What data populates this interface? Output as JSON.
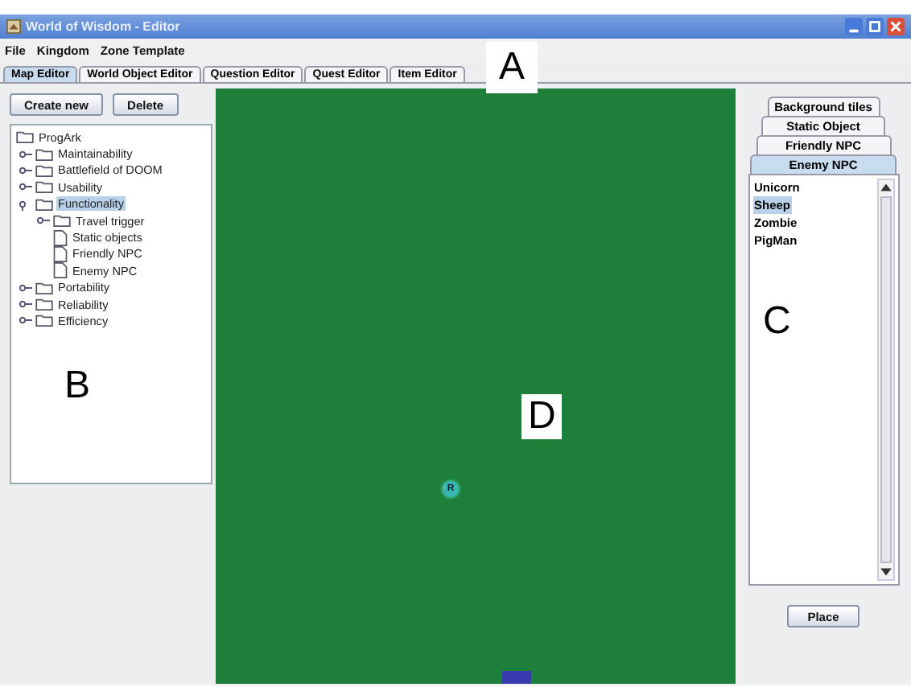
{
  "window": {
    "title": "World of Wisdom - Editor"
  },
  "menu": [
    "File",
    "Kingdom",
    "Zone Template"
  ],
  "tabs": [
    {
      "label": "Map Editor",
      "selected": true
    },
    {
      "label": "World Object Editor",
      "selected": false
    },
    {
      "label": "Question Editor",
      "selected": false
    },
    {
      "label": "Quest Editor",
      "selected": false
    },
    {
      "label": "Item Editor",
      "selected": false
    }
  ],
  "left_panel": {
    "buttons": [
      "Create new",
      "Delete"
    ],
    "tree": {
      "label": "ProgArk",
      "children": [
        {
          "label": "Maintainability",
          "kind": "folder",
          "expanded": false,
          "selected": false
        },
        {
          "label": "Battlefield of DOOM",
          "kind": "folder",
          "expanded": false,
          "selected": false
        },
        {
          "label": "Usability",
          "kind": "folder",
          "expanded": false,
          "selected": false
        },
        {
          "label": "Functionality",
          "kind": "folder",
          "expanded": true,
          "selected": true,
          "children": [
            {
              "label": "Travel trigger",
              "kind": "folder",
              "expanded": false,
              "selected": false
            },
            {
              "label": "Static objects",
              "kind": "file",
              "selected": false
            },
            {
              "label": "Friendly NPC",
              "kind": "file",
              "selected": false
            },
            {
              "label": "Enemy NPC",
              "kind": "file",
              "selected": false
            }
          ]
        },
        {
          "label": "Portability",
          "kind": "folder",
          "expanded": false,
          "selected": false
        },
        {
          "label": "Reliability",
          "kind": "folder",
          "expanded": false,
          "selected": false
        },
        {
          "label": "Efficiency",
          "kind": "folder",
          "expanded": false,
          "selected": false
        }
      ]
    }
  },
  "right_panel": {
    "tabs": [
      {
        "label": "Background tiles",
        "selected": false
      },
      {
        "label": "Static Object",
        "selected": false
      },
      {
        "label": "Friendly NPC",
        "selected": false
      },
      {
        "label": "Enemy NPC",
        "selected": true
      }
    ],
    "list": [
      {
        "label": "Unicorn",
        "selected": false
      },
      {
        "label": "Sheep",
        "selected": true
      },
      {
        "label": "Zombie",
        "selected": false
      },
      {
        "label": "PigMan",
        "selected": false
      }
    ],
    "button": "Place"
  },
  "map": {
    "marker": "R"
  },
  "annotations": [
    "A",
    "B",
    "C",
    "D"
  ]
}
